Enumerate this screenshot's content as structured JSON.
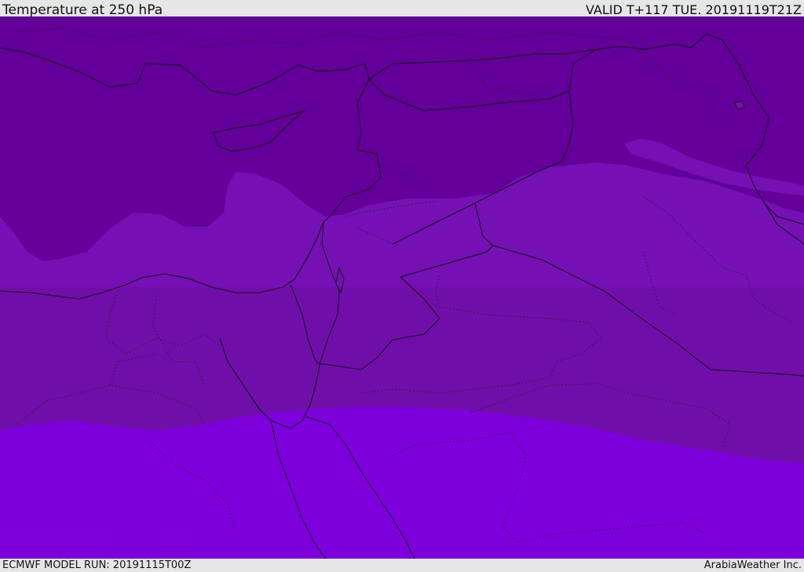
{
  "header": {
    "title": "Temperature at 250 hPa",
    "valid": "VALID T+117 TUE. 20191119T21Z"
  },
  "footer": {
    "model_run": "ECMWF MODEL RUN: 20191115T00Z",
    "credit": "ArabiaWeather Inc."
  },
  "colors": {
    "band_cold": "#620099",
    "band_mid_1": "#7410b4",
    "band_mid_2": "#700eaa",
    "band_warm": "#7d00dc",
    "lines": "#111111"
  }
}
